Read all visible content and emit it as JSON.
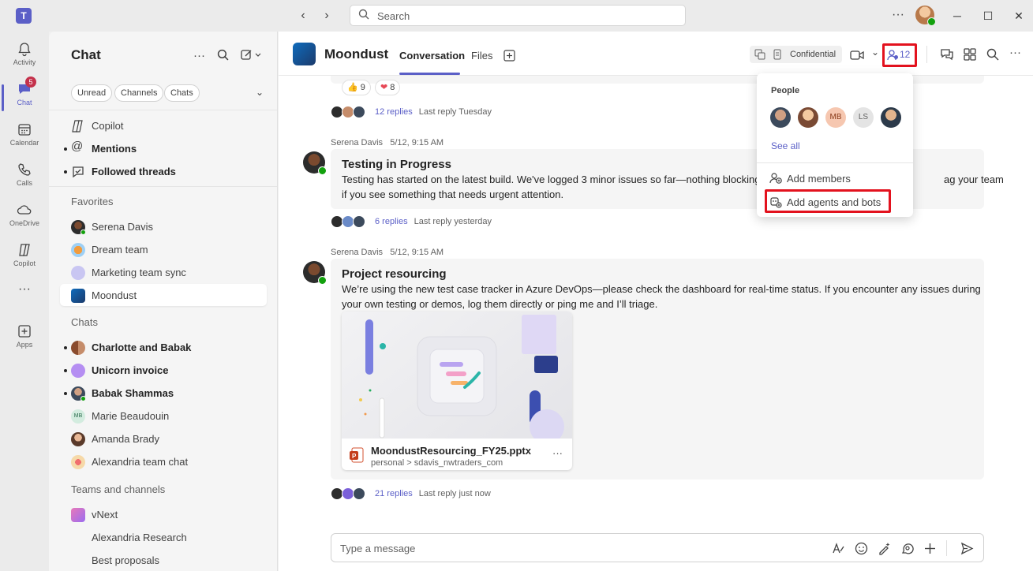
{
  "titlebar": {
    "search_placeholder": "Search",
    "more_label": "···"
  },
  "rail": {
    "items": [
      {
        "label": "Activity",
        "icon": "bell-icon"
      },
      {
        "label": "Chat",
        "icon": "chat-icon",
        "badge": "5"
      },
      {
        "label": "Calendar",
        "icon": "calendar-icon"
      },
      {
        "label": "Calls",
        "icon": "phone-icon"
      },
      {
        "label": "OneDrive",
        "icon": "cloud-icon"
      },
      {
        "label": "Copilot",
        "icon": "copilot-icon"
      },
      {
        "label": "Apps",
        "icon": "apps-icon"
      }
    ],
    "more_label": "···"
  },
  "sidebar": {
    "title": "Chat",
    "filters": [
      "Unread",
      "Channels",
      "Chats"
    ],
    "top_items": [
      {
        "label": "Copilot",
        "bold": false
      },
      {
        "label": "Mentions",
        "bold": true
      },
      {
        "label": "Followed threads",
        "bold": true
      }
    ],
    "sections": {
      "favorites": "Favorites",
      "chats": "Chats",
      "teams": "Teams and channels"
    },
    "favorites": [
      "Serena Davis",
      "Dream team",
      "Marketing team sync",
      "Moondust"
    ],
    "chats": [
      {
        "label": "Charlotte and Babak",
        "bold": true
      },
      {
        "label": "Unicorn invoice",
        "bold": true
      },
      {
        "label": "Babak Shammas",
        "bold": true
      },
      {
        "label": "Marie Beaudouin",
        "bold": false,
        "initials": "MB"
      },
      {
        "label": "Amanda Brady",
        "bold": false
      },
      {
        "label": "Alexandria team chat",
        "bold": false
      }
    ],
    "teams": [
      "vNext",
      "Alexandria Research",
      "Best proposals"
    ]
  },
  "channel": {
    "name": "Moondust",
    "tabs": [
      "Conversation",
      "Files"
    ],
    "sensitivity": "Confidential",
    "people_count": "12"
  },
  "popover": {
    "title": "People",
    "avatars": [
      "",
      "",
      "MB",
      "LS",
      ""
    ],
    "see_all": "See all",
    "add_members": "Add members",
    "add_agents": "Add agents and bots"
  },
  "messages": [
    {
      "reactions": [
        {
          "emoji": "👍",
          "count": "9"
        },
        {
          "emoji": "❤",
          "count": "8"
        }
      ],
      "replies": "12 replies",
      "last_reply": "Last reply Tuesday"
    },
    {
      "sender": "Serena Davis",
      "time": "5/12, 9:15 AM",
      "title": "Testing in Progress",
      "body_line1": "Testing has started on the latest build. We've logged 3 minor issues so far—nothing blocking.",
      "body_line1_tail": "ag your team",
      "body_line2": "if you see something that needs urgent attention.",
      "replies": "6 replies",
      "last_reply": "Last reply yesterday"
    },
    {
      "sender": "Serena Davis",
      "time": "5/12, 9:15 AM",
      "title": "Project resourcing",
      "body_line1": "We’re using the new test case tracker in Azure DevOps—please check the dashboard for real-time status. If you encounter any issues during",
      "body_line2": "your own testing or demos, log them directly or ping me and I’ll triage.",
      "attachment": {
        "name": "MoondustResourcing_FY25.pptx",
        "path": "personal > sdavis_nwtraders_com",
        "more": "···"
      },
      "replies": "21 replies",
      "last_reply": "Last reply just now"
    }
  ],
  "composer": {
    "placeholder": "Type a message"
  },
  "colors": {
    "brand": "#5b5fc7",
    "highlight": "#e3121e",
    "presence": "#13a10e"
  }
}
